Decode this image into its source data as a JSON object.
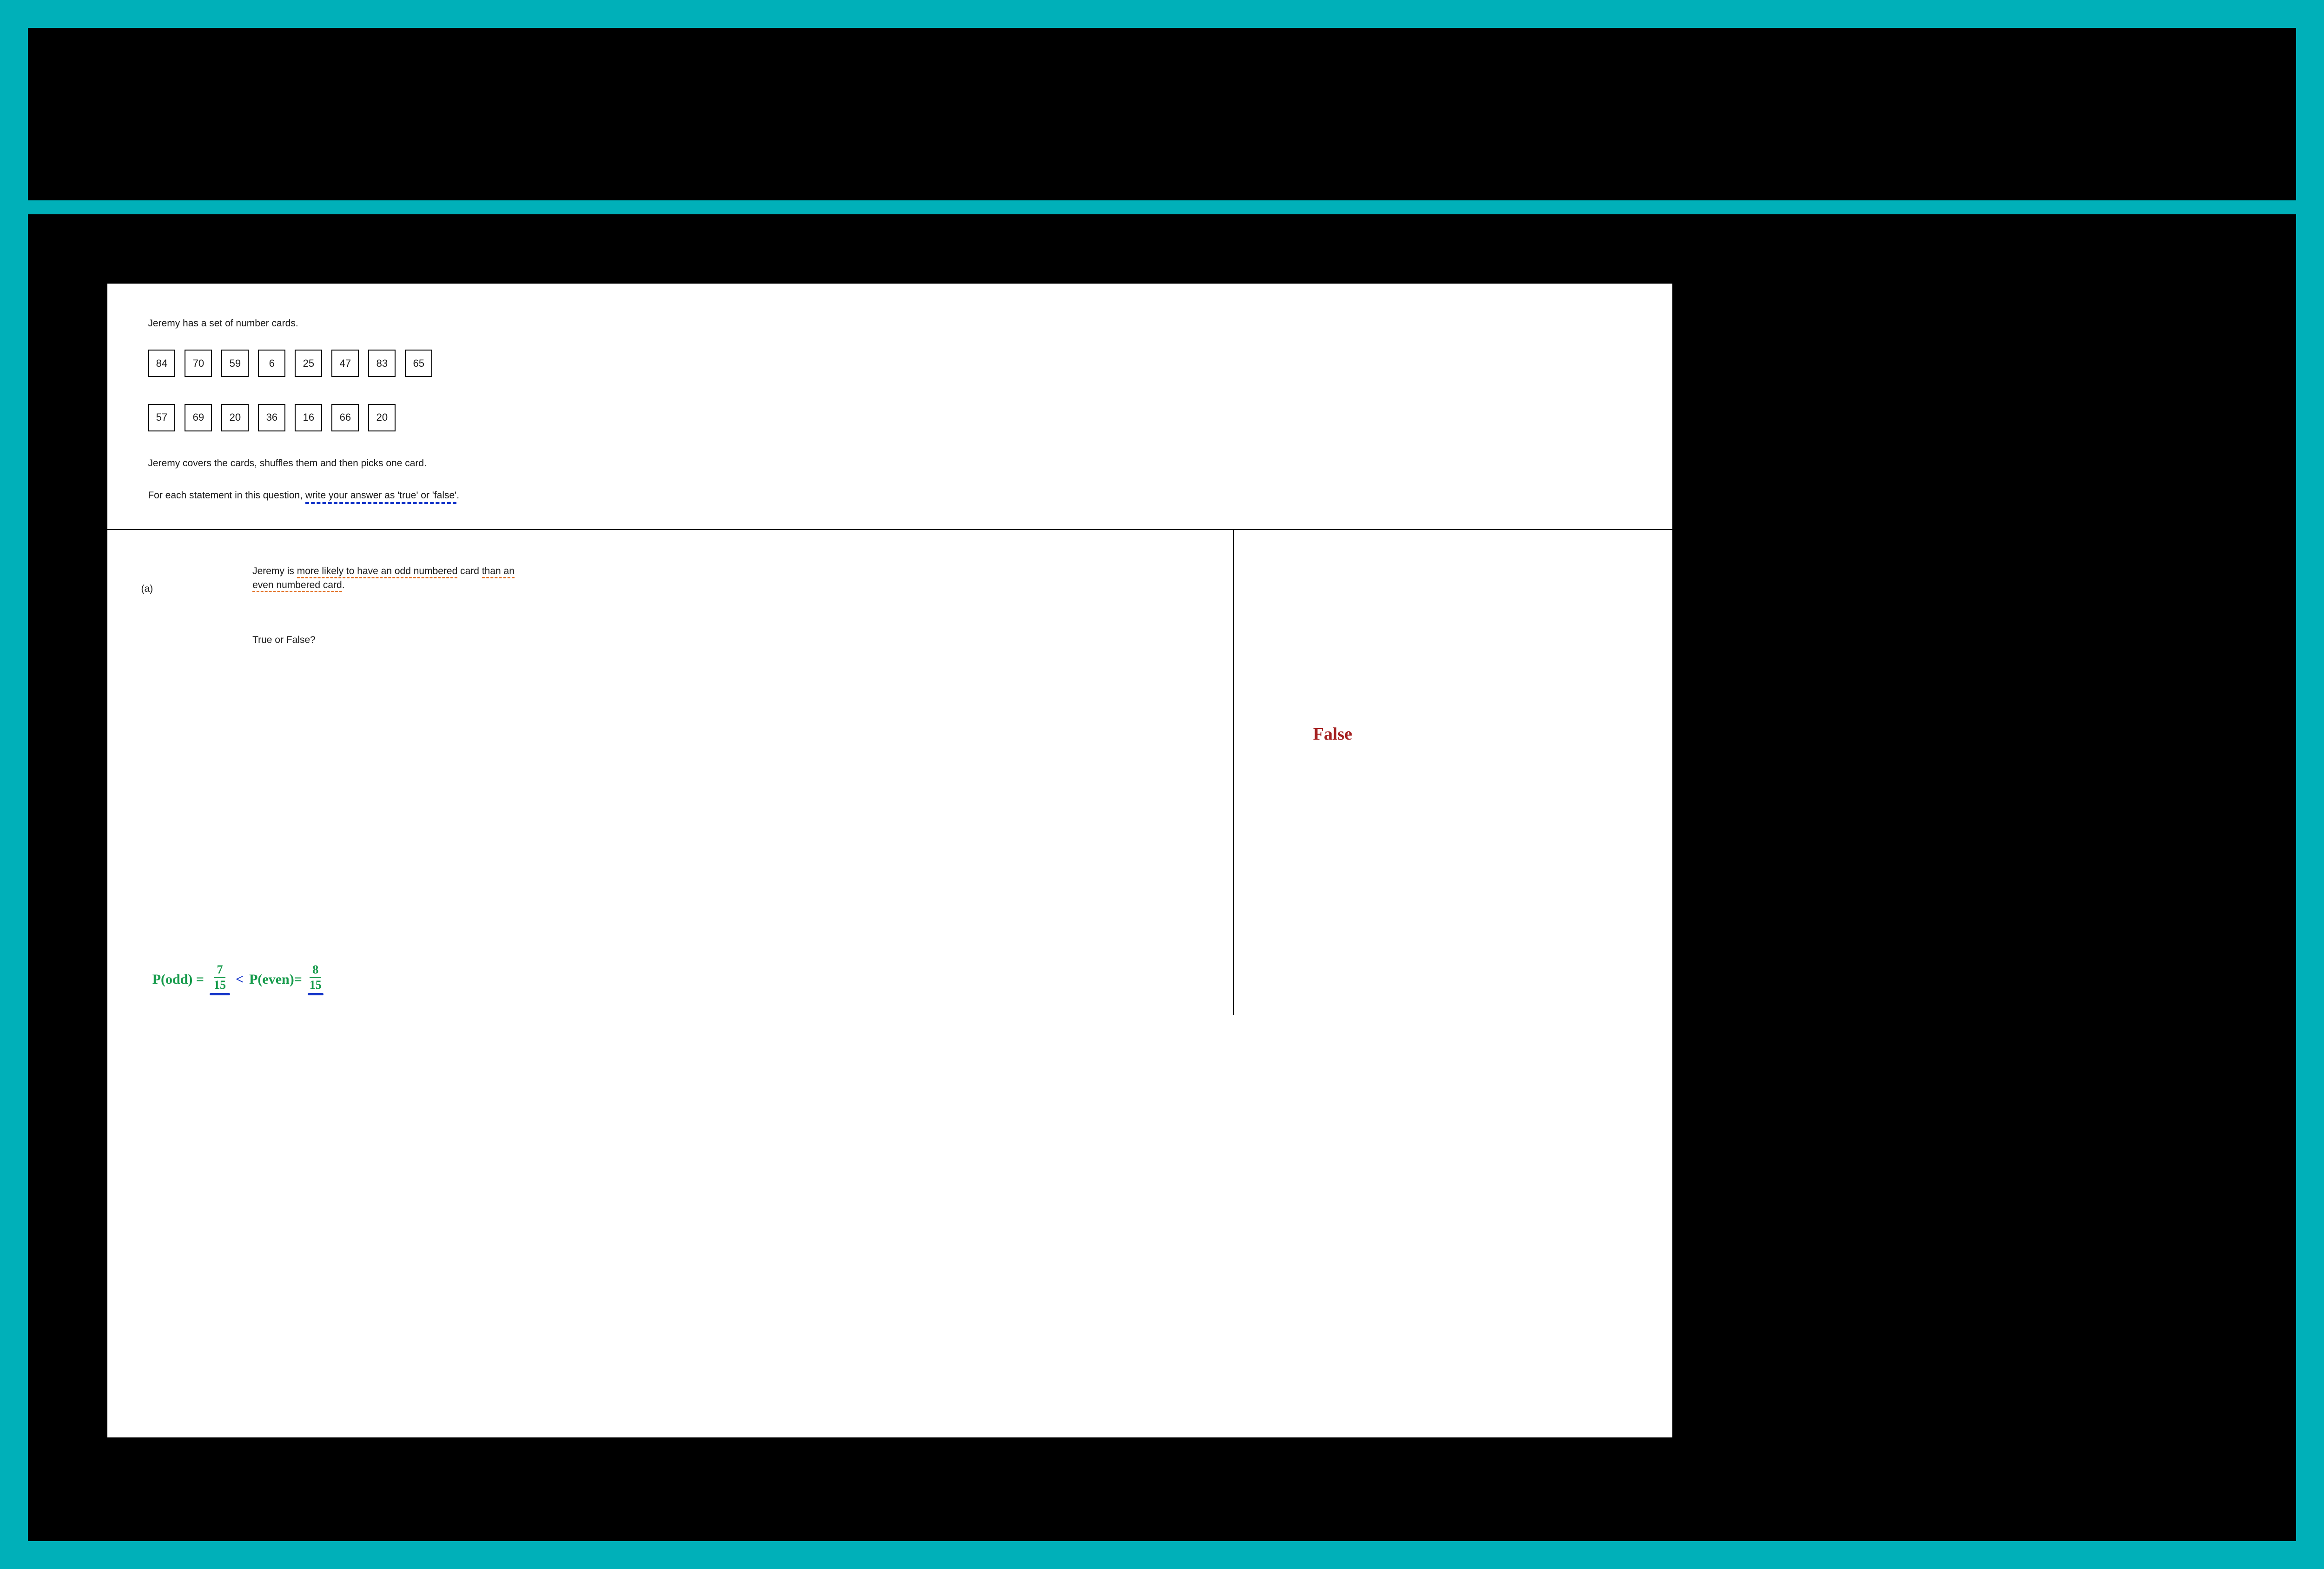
{
  "question": {
    "intro": "Jeremy has a set of number cards.",
    "cards_row1": [
      "84",
      "70",
      "59",
      "6",
      "25",
      "47",
      "83",
      "65"
    ],
    "cards_row2": [
      "57",
      "69",
      "20",
      "36",
      "16",
      "66",
      "20"
    ],
    "shuffle_line": "Jeremy covers the cards, shuffles them and then picks one card.",
    "instruction_prefix": "For each statement in this question, ",
    "instruction_underlined": "write your answer as 'true' or 'false'",
    "instruction_suffix": "."
  },
  "part_a": {
    "label": "(a)",
    "text_plain_1": "Jeremy is ",
    "u1": "more likely to have an odd numbered",
    "text_plain_2": " card ",
    "u2": "than an",
    "text_plain_3": " ",
    "u3": "even numbered card",
    "text_plain_4": ".",
    "prompt": "True or False?"
  },
  "working": {
    "p_odd_label": "P(odd) =",
    "p_odd_num": "7",
    "p_odd_den": "15",
    "comparator": "<",
    "p_even_label": "P(even)=",
    "p_even_num": "8",
    "p_even_den": "15"
  },
  "answer": "False"
}
